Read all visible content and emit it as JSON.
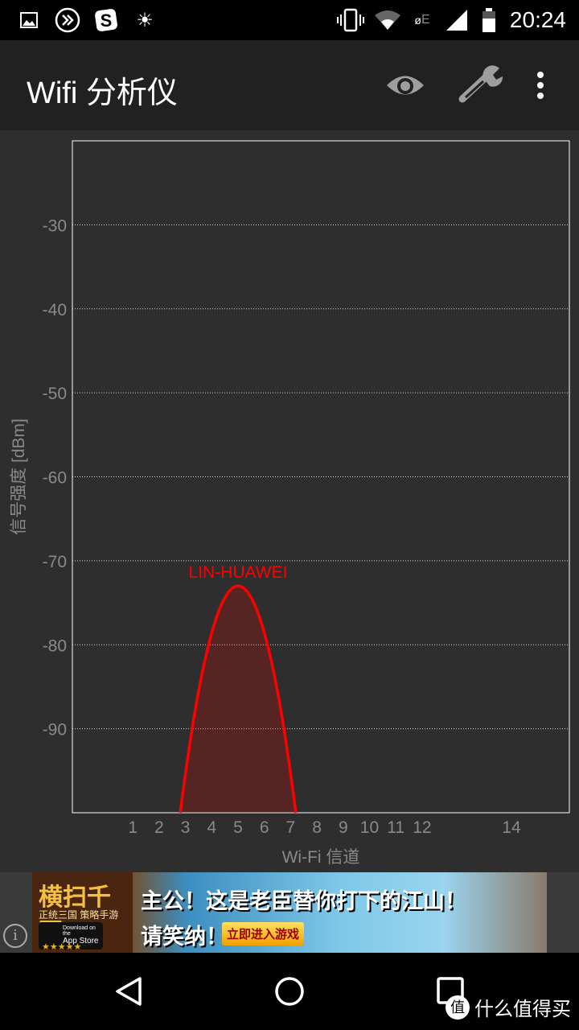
{
  "status_bar": {
    "time": "20:24",
    "icons": [
      "image-icon",
      "forward-circle-icon",
      "sogou-s-icon",
      "brightness-icon",
      "vibrate-icon",
      "wifi-icon",
      "data-e-icon",
      "cell-signal-icon",
      "battery-icon"
    ]
  },
  "app_bar": {
    "title": "Wifi 分析仪",
    "actions": [
      "eye-icon",
      "wrench-icon",
      "more-vert-icon"
    ]
  },
  "chart_data": {
    "type": "area",
    "xlabel": "Wi-Fi 信道",
    "ylabel": "信号强度 [dBm]",
    "x_ticks": [
      "1",
      "2",
      "3",
      "4",
      "5",
      "6",
      "7",
      "8",
      "9",
      "10",
      "11",
      "12",
      "14"
    ],
    "y_ticks": [
      -30,
      -40,
      -50,
      -60,
      -70,
      -80,
      -90
    ],
    "ylim": [
      -100,
      -20
    ],
    "xlim": [
      -1.3,
      17.6
    ],
    "grid": "horizontal dotted",
    "series": [
      {
        "name": "LIN-HUAWEI",
        "channel": 5,
        "signal_dbm": -73,
        "color": "#ff0000"
      }
    ]
  },
  "ad": {
    "game_title": "横扫千军",
    "game_subtitle": "正统三国 策略手游",
    "store_badge": "App Store",
    "store_badge_top": "Download on the",
    "stars": "★★★★★",
    "slogan1": "主公！这是老臣替你打下的江山！",
    "slogan2": "请笑纳！",
    "cta": "立即进入游戏",
    "info_icon": "i"
  },
  "nav_bar": {
    "buttons": [
      "back-icon",
      "home-icon",
      "recents-icon"
    ]
  },
  "watermark": {
    "badge": "值",
    "text": "什么值得买"
  }
}
